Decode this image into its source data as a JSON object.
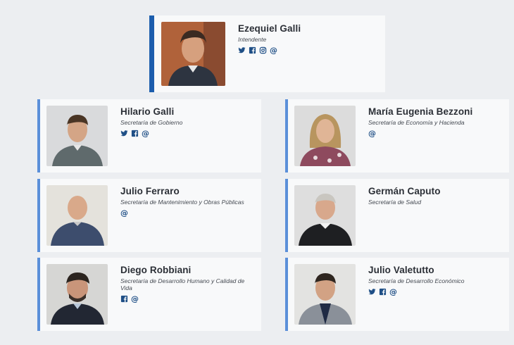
{
  "head": {
    "name": "Ezequiel Galli",
    "role": "Intendente",
    "icons": [
      "twitter-icon",
      "facebook-icon",
      "instagram-icon",
      "email-icon"
    ]
  },
  "members": [
    {
      "name": "Hilario Galli",
      "role": "Secretaría de Gobierno",
      "icons": [
        "twitter-icon",
        "facebook-icon",
        "email-icon"
      ]
    },
    {
      "name": "María Eugenia Bezzoni",
      "role": "Secretaría de Economía y Hacienda",
      "icons": [
        "email-icon"
      ]
    },
    {
      "name": "Julio Ferraro",
      "role": "Secretaría de Mantenimiento y Obras Públicas",
      "icons": [
        "email-icon"
      ]
    },
    {
      "name": "Germán Caputo",
      "role": "Secretaría de Salud",
      "icons": []
    },
    {
      "name": "Diego Robbiani",
      "role": "Secretaría de Desarrollo Humano y Calidad de Vida",
      "icons": [
        "facebook-icon",
        "email-icon"
      ]
    },
    {
      "name": "Julio Valetutto",
      "role": "Secretaría de Desarrollo Económico",
      "icons": [
        "twitter-icon",
        "facebook-icon",
        "email-icon"
      ]
    }
  ],
  "colors": {
    "accent": "#1c5dad",
    "accent_light": "#5b8fd9",
    "icon": "#1f4f86"
  }
}
